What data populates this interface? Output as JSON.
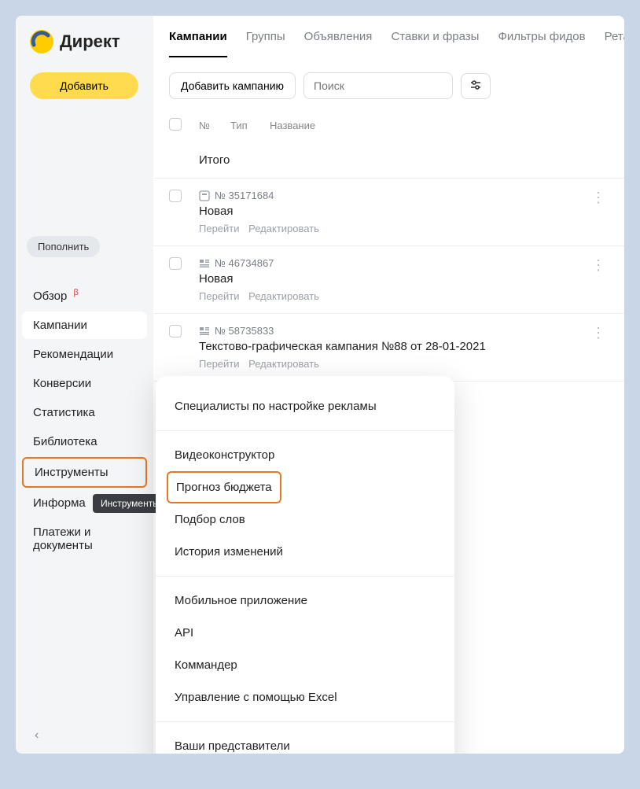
{
  "brand": "Директ",
  "header": {
    "tabs": [
      "Кампании",
      "Группы",
      "Объявления",
      "Ставки и фразы",
      "Фильтры фидов",
      "Ретарге"
    ],
    "active_tab_index": 0
  },
  "toolbar": {
    "add_button": "Добавить",
    "add_campaign": "Добавить кампанию",
    "search_placeholder": "Поиск"
  },
  "sidebar": {
    "topup": "Пополнить",
    "items": [
      {
        "label": "Обзор",
        "beta": "β"
      },
      {
        "label": "Кампании"
      },
      {
        "label": "Рекомендации"
      },
      {
        "label": "Конверсии"
      },
      {
        "label": "Статистика"
      },
      {
        "label": "Библиотека"
      },
      {
        "label": "Инструменты"
      },
      {
        "label": "Информа"
      },
      {
        "label": "Платежи и документы"
      }
    ],
    "active_index": 1,
    "highlighted_index": 6,
    "tooltip": "Инструменты"
  },
  "table": {
    "headers": {
      "num": "№",
      "type": "Тип",
      "name": "Название"
    },
    "total_label": "Итого",
    "actions": {
      "goto": "Перейти",
      "edit": "Редактировать"
    },
    "rows": [
      {
        "id": "№ 35171684",
        "title": "Новая"
      },
      {
        "id": "№ 46734867",
        "title": "Новая"
      },
      {
        "id": "№ 58735833",
        "title": "Текстово-графическая кампания №88 от 28-01-2021"
      }
    ]
  },
  "popup": {
    "groups": [
      [
        "Специалисты по настройке рекламы"
      ],
      [
        "Видеоконструктор",
        "Прогноз бюджета",
        "Подбор слов",
        "История изменений"
      ],
      [
        "Мобильное приложение",
        "API",
        "Коммандер",
        "Управление с помощью Excel"
      ],
      [
        "Ваши представители"
      ]
    ],
    "highlighted": "Прогноз бюджета"
  }
}
